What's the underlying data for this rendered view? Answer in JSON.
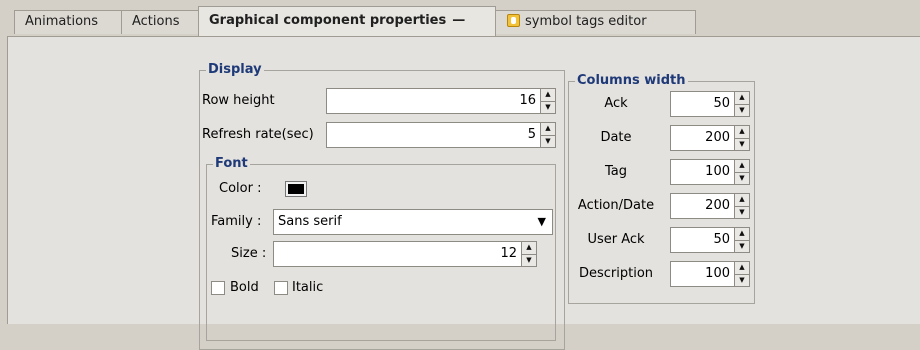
{
  "tabs": {
    "animations": "Animations",
    "actions": "Actions",
    "graphical": "Graphical component properties",
    "graphical_close": "—",
    "symbol_tags": "symbol tags editor"
  },
  "display": {
    "title": "Display",
    "row_height_label": "Row height",
    "row_height_value": "16",
    "refresh_label": "Refresh rate(sec)",
    "refresh_value": "5"
  },
  "font": {
    "title": "Font",
    "color_label": "Color :",
    "color_value": "#000000",
    "family_label": "Family :",
    "family_value": "Sans serif",
    "size_label": "Size :",
    "size_value": "12",
    "bold_label": "Bold",
    "bold_checked": false,
    "italic_label": "Italic",
    "italic_checked": false
  },
  "columns": {
    "title": "Columns width",
    "rows": [
      {
        "label": "Ack",
        "value": "50"
      },
      {
        "label": "Date",
        "value": "200"
      },
      {
        "label": "Tag",
        "value": "100"
      },
      {
        "label": "Action/Date",
        "value": "200"
      },
      {
        "label": "User Ack",
        "value": "50"
      },
      {
        "label": "Description",
        "value": "100"
      }
    ]
  }
}
